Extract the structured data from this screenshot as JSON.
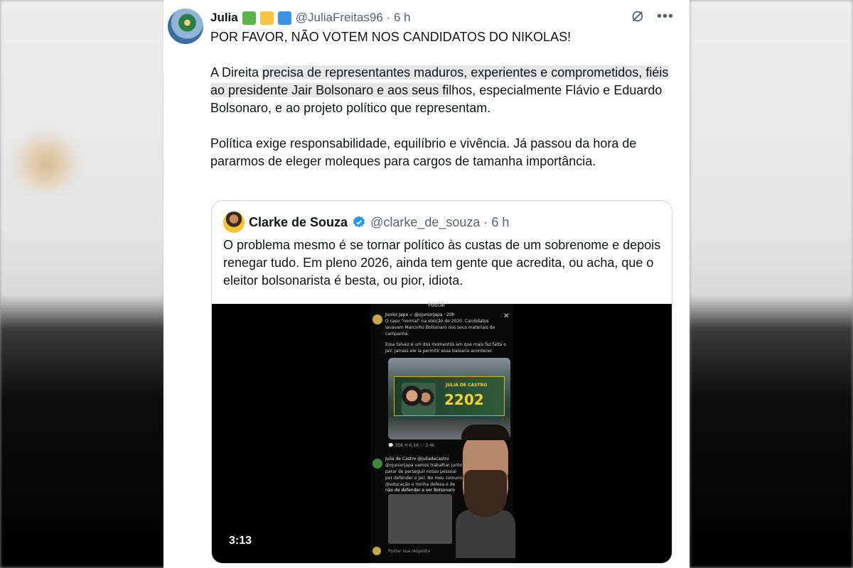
{
  "colors": {
    "card_bg": "#ffffff",
    "text_primary": "#0f1419",
    "text_secondary": "#536471",
    "verified_blue": "#1d9bf0",
    "flag_green": "#5bb64a",
    "flag_yellow": "#f5c542",
    "flag_blue": "#3b94e8"
  },
  "tweet": {
    "author_name": "Julia",
    "handle_time": "@JuliaFreitas96 · 6 h",
    "paragraph1": "POR FAVOR, NÃO VOTEM NOS CANDIDATOS DO NIKOLAS!",
    "paragraph2_pre": "A Direita ",
    "paragraph2_hl1": "precisa de representantes maduros, experientes e ",
    "paragraph2_hl2": "comprometidos, fiéis ao presidente Jair Bolsonaro e aos seus fi",
    "paragraph2_post": "lhos, especialmente Flávio e Eduardo Bolsonaro, e ao projeto político que representam.",
    "paragraph3": "Política exige responsabilidade, equilíbrio e vivência. Já passou da hora de pararmos de eleger moleques para cargos de tamanha importância."
  },
  "quote": {
    "author_name": "Clarke de Souza",
    "handle_time": "@clarke_de_souza · 6 h",
    "text": "O problema mesmo é se tornar político às custas de um sobrenome e depois renegar tudo. Em pleno 2026, ainda tem gente que acredita, ou acha, que o eleitor bolsonarista é besta, ou pior, idiota.",
    "video_duration": "3:13"
  },
  "video_inner": {
    "title": "Postar",
    "post1_header": "Junior Japa ✓ @ojuniorjapa · 20h",
    "post1_line1": "O caso \"normal\" na eleição de 2020. Candidatos",
    "post1_line2": "lavavam Marcinho Bolsonaro nos seus materiais de",
    "post1_line3": "campanha.",
    "post1_line4": "Essa talvez é um dos momentos em que mais faz falta o",
    "post1_line5": "Jair. Jamais ele ia permitir essa baixaria acontecer.",
    "banner_name": "JULIA DE CASTRO",
    "banner_number": "2202",
    "metrics": "💬 356    ⟲ 6.1K    ♡ 2.4k",
    "post2_header": "Julia de Castro @juliadecastro",
    "post2_line1": "@ojuniorjapa vamos trabalhar junto",
    "post2_line2": "parar de perseguir nosso pessoal",
    "post2_line3": "por defender o Jair. No meu comunicado",
    "post2_line4": "@educação e minha defesa é de",
    "post2_line5": "não de defender e ser Bolsonaro",
    "reply_placeholder": "Postar sua resposta"
  },
  "icons": {
    "grok": "grok-icon",
    "more": "more-options-icon",
    "verified": "verified-badge-icon"
  }
}
